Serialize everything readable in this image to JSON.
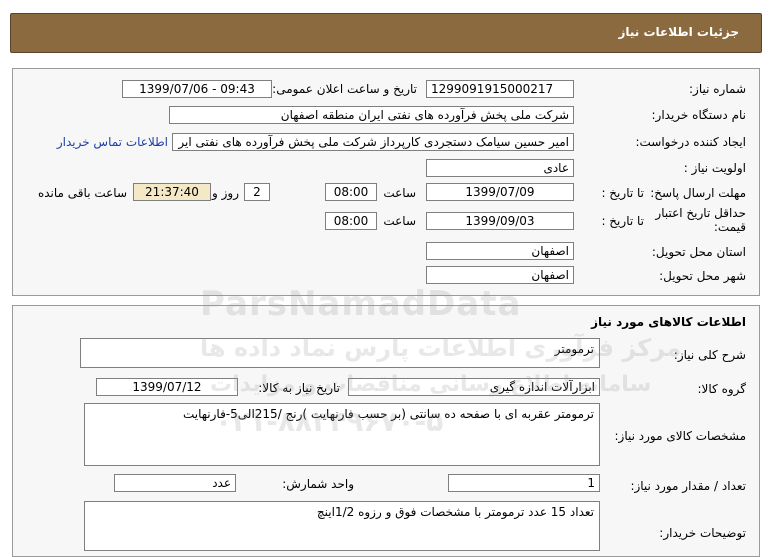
{
  "header": {
    "title": "جزئیات اطلاعات نیاز"
  },
  "info": {
    "need_number_label": "شماره نیاز:",
    "need_number": "1299091915000217",
    "announce_label": "تاریخ و ساعت اعلان عمومی:",
    "announce_value": "1399/07/06 - 09:43",
    "buyer_label": "نام دستگاه خریدار:",
    "buyer_value": "شرکت ملی پخش فرآورده های نفتی ایران منطقه اصفهان",
    "creator_label": "ایجاد کننده درخواست:",
    "creator_value": "امیر حسین  سیامک دستجردی کارپرداز شرکت ملی پخش فرآورده های نفتی ایر",
    "contact_link": "اطلاعات تماس خریدار",
    "priority_label": "اولویت نیاز :",
    "priority_value": "عادی",
    "deadline_label": "مهلت ارسال پاسخ:",
    "until_date_label": "تا تاریخ :",
    "deadline_date": "1399/07/09",
    "time_label": "ساعت",
    "deadline_time": "08:00",
    "days_value": "2",
    "days_label": "روز و",
    "remaining_time": "21:37:40",
    "remaining_label": "ساعت باقی مانده",
    "validity_label": "حداقل تاریخ اعتبار قیمت:",
    "validity_date": "1399/09/03",
    "validity_time": "08:00",
    "province_label": "استان محل تحویل:",
    "province_value": "اصفهان",
    "city_label": "شهر محل تحویل:",
    "city_value": "اصفهان"
  },
  "goods": {
    "section_title": "اطلاعات کالاهای مورد نیاز",
    "summary_label": "شرح کلی نیاز:",
    "summary_value": "ترمومتر",
    "group_label": "گروه کالا:",
    "group_value": "ابزارآلات اندازه گیری",
    "need_date_label": "تاریخ نیاز به کالا:",
    "need_date_value": "1399/07/12",
    "spec_label": "مشخصات کالای مورد نیاز:",
    "spec_value": "ترمومتر عقربه ای با صفحه ده سانتی (بر حسب فارنهایت )رنج /215الی5-فارنهایت",
    "qty_label": "تعداد / مقدار مورد نیاز:",
    "qty_value": "1",
    "unit_label": "واحد شمارش:",
    "unit_value": "عدد",
    "buyer_notes_label": "توضیحات خریدار:",
    "buyer_notes_value": "تعداد 15 عدد ترمومتر با مشخصات فوق و رزوه 1/2اینچ"
  },
  "watermark": {
    "brand": "ParsNamadData",
    "slogan": "مرکز فرآوری اطلاعات پارس نماد داده ها",
    "slogan2": "سامانه اطلاع رسانی مناقصات و مزایدات",
    "phone": "۰۲۱-۸۸۳۴۹۶۷۰-۵"
  }
}
